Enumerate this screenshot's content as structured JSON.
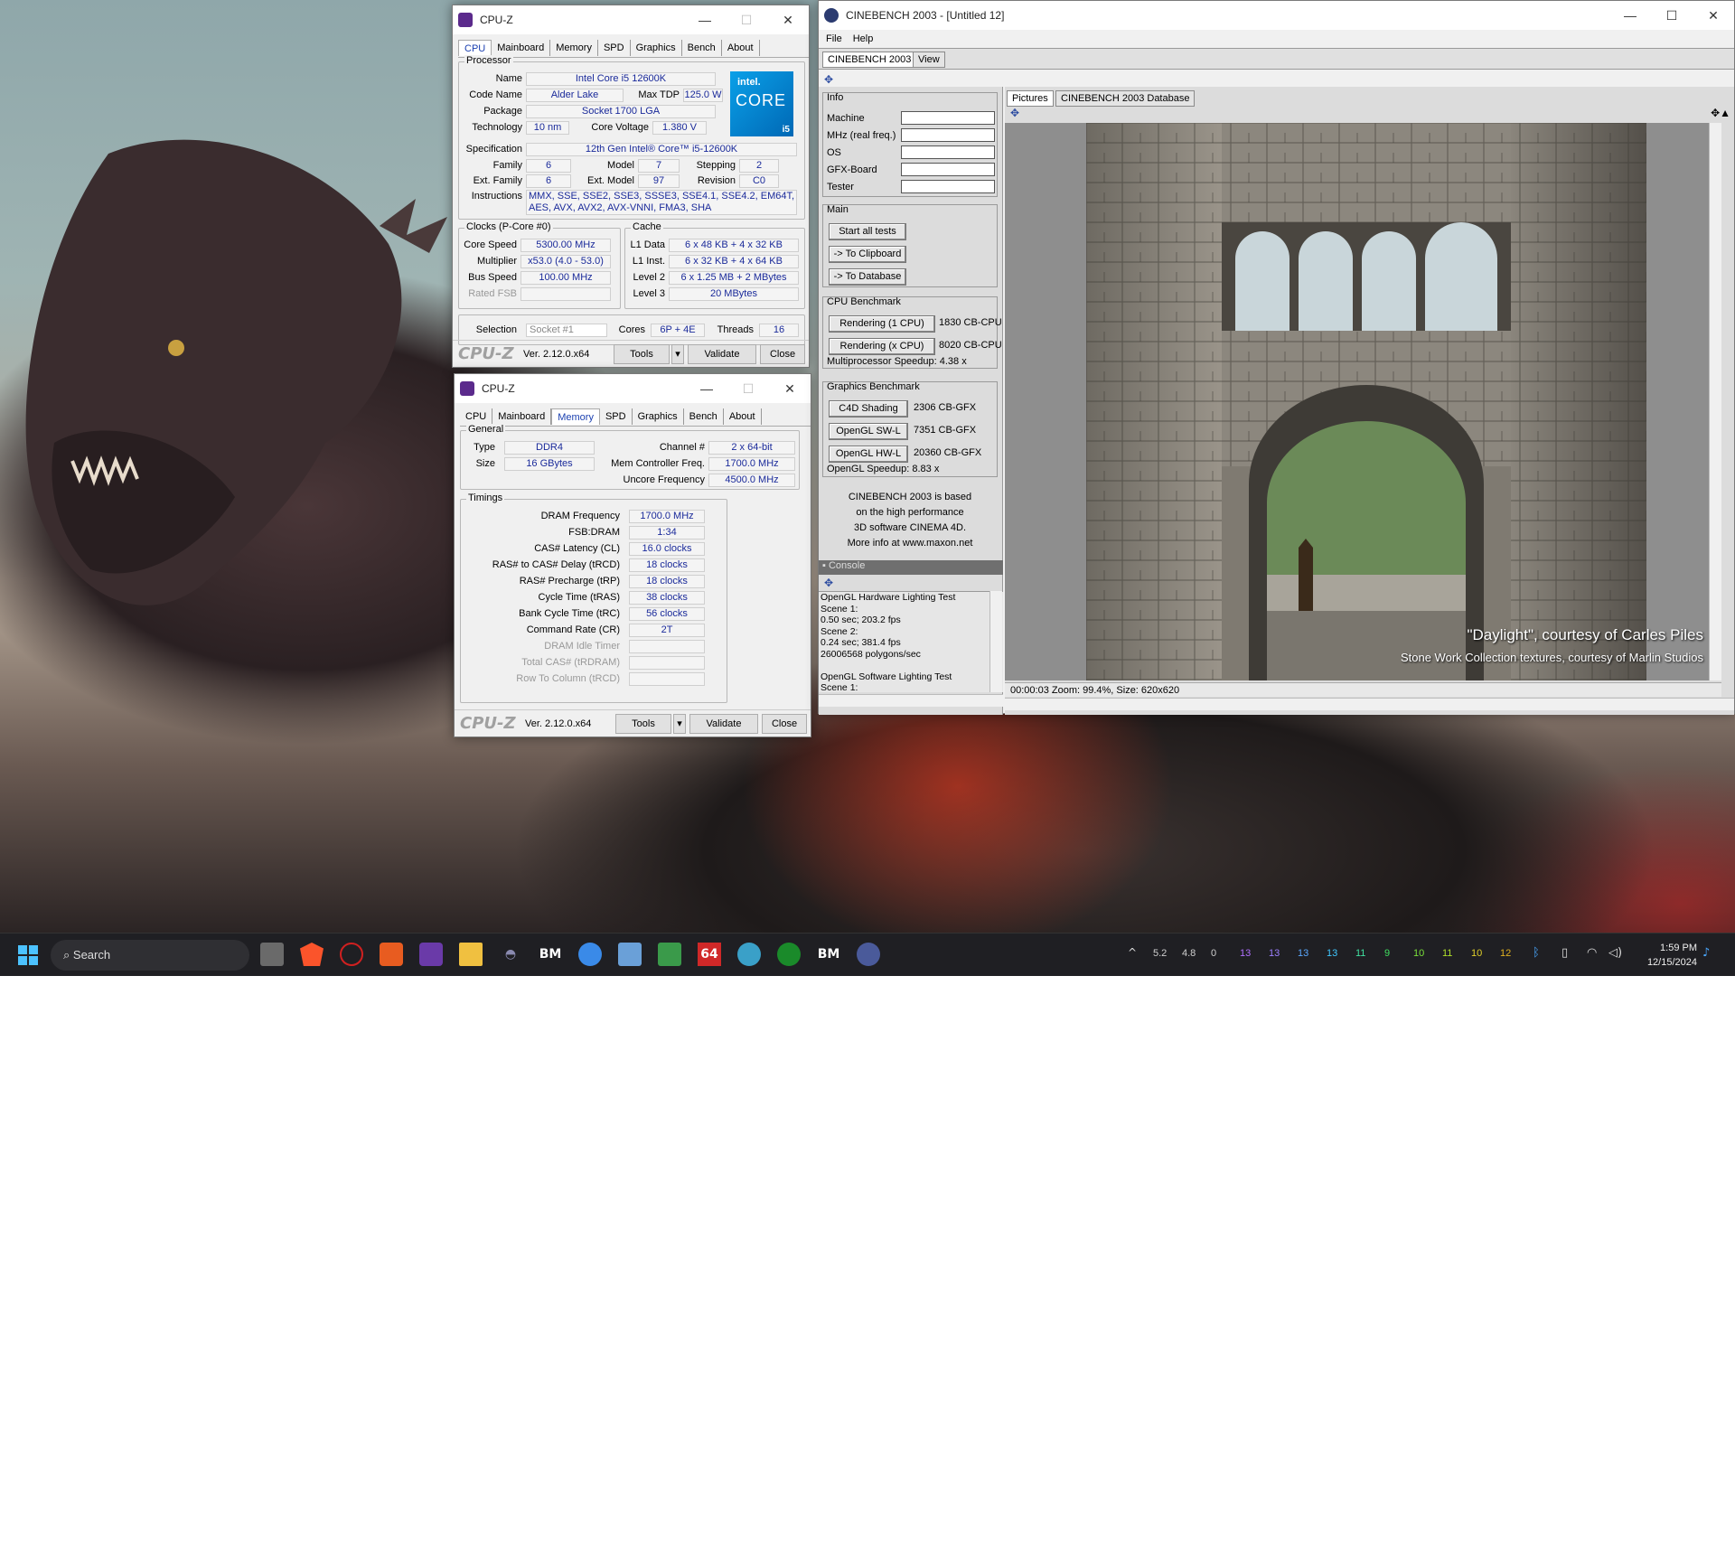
{
  "desktop": {
    "wallpaper": "godzilla-wallpaper"
  },
  "cpuz1": {
    "title": "CPU-Z",
    "tabs": [
      "CPU",
      "Mainboard",
      "Memory",
      "SPD",
      "Graphics",
      "Bench",
      "About"
    ],
    "active_tab": "CPU",
    "processor": {
      "group": "Processor",
      "name_label": "Name",
      "name": "Intel Core i5 12600K",
      "code_label": "Code Name",
      "code": "Alder Lake",
      "tdp_label": "Max TDP",
      "tdp": "125.0 W",
      "package_label": "Package",
      "package": "Socket 1700 LGA",
      "tech_label": "Technology",
      "tech": "10 nm",
      "voltage_label": "Core Voltage",
      "voltage": "1.380 V",
      "spec_label": "Specification",
      "spec": "12th Gen Intel® Core™ i5-12600K",
      "family_label": "Family",
      "family": "6",
      "model_label": "Model",
      "model": "7",
      "stepping_label": "Stepping",
      "stepping": "2",
      "extfamily_label": "Ext. Family",
      "extfamily": "6",
      "extmodel_label": "Ext. Model",
      "extmodel": "97",
      "revision_label": "Revision",
      "revision": "C0",
      "instr_label": "Instructions",
      "instr": "MMX, SSE, SSE2, SSE3, SSSE3, SSE4.1, SSE4.2, EM64T, AES, AVX, AVX2, AVX-VNNI, FMA3, SHA"
    },
    "logo": {
      "brand": "intel.",
      "line": "CORE",
      "tier": "i5"
    },
    "clocks": {
      "group": "Clocks (P-Core #0)",
      "speed_label": "Core Speed",
      "speed": "5300.00 MHz",
      "mult_label": "Multiplier",
      "mult": "x53.0 (4.0 - 53.0)",
      "bus_label": "Bus Speed",
      "bus": "100.00 MHz",
      "fsb_label": "Rated FSB",
      "fsb": ""
    },
    "cache": {
      "group": "Cache",
      "l1d_label": "L1 Data",
      "l1d": "6 x 48 KB + 4 x 32 KB",
      "l1i_label": "L1 Inst.",
      "l1i": "6 x 32 KB + 4 x 64 KB",
      "l2_label": "Level 2",
      "l2": "6 x 1.25 MB + 2 MBytes",
      "l3_label": "Level 3",
      "l3": "20 MBytes"
    },
    "sel": {
      "sel_label": "Selection",
      "sel": "Socket #1",
      "cores_label": "Cores",
      "cores": "6P + 4E",
      "threads_label": "Threads",
      "threads": "16"
    },
    "footer": {
      "logo": "CPU-Z",
      "ver": "Ver. 2.12.0.x64",
      "tools": "Tools",
      "validate": "Validate",
      "close": "Close"
    }
  },
  "cpuz2": {
    "title": "CPU-Z",
    "tabs": [
      "CPU",
      "Mainboard",
      "Memory",
      "SPD",
      "Graphics",
      "Bench",
      "About"
    ],
    "active_tab": "Memory",
    "general": {
      "group": "General",
      "type_label": "Type",
      "type": "DDR4",
      "size_label": "Size",
      "size": "16 GBytes",
      "channel_label": "Channel #",
      "channel": "2 x 64-bit",
      "mcf_label": "Mem Controller Freq.",
      "mcf": "1700.0 MHz",
      "uncore_label": "Uncore Frequency",
      "uncore": "4500.0 MHz"
    },
    "timings": {
      "group": "Timings",
      "rows": [
        {
          "label": "DRAM Frequency",
          "value": "1700.0 MHz",
          "dis": false
        },
        {
          "label": "FSB:DRAM",
          "value": "1:34",
          "dis": false
        },
        {
          "label": "CAS# Latency (CL)",
          "value": "16.0 clocks",
          "dis": false
        },
        {
          "label": "RAS# to CAS# Delay (tRCD)",
          "value": "18 clocks",
          "dis": false
        },
        {
          "label": "RAS# Precharge (tRP)",
          "value": "18 clocks",
          "dis": false
        },
        {
          "label": "Cycle Time (tRAS)",
          "value": "38 clocks",
          "dis": false
        },
        {
          "label": "Bank Cycle Time (tRC)",
          "value": "56 clocks",
          "dis": false
        },
        {
          "label": "Command Rate (CR)",
          "value": "2T",
          "dis": false
        },
        {
          "label": "DRAM Idle Timer",
          "value": "",
          "dis": true
        },
        {
          "label": "Total CAS# (tRDRAM)",
          "value": "",
          "dis": true
        },
        {
          "label": "Row To Column (tRCD)",
          "value": "",
          "dis": true
        }
      ]
    },
    "footer": {
      "logo": "CPU-Z",
      "ver": "Ver. 2.12.0.x64",
      "tools": "Tools",
      "validate": "Validate",
      "close": "Close"
    }
  },
  "cine": {
    "title": "CINEBENCH 2003 - [Untitled 12]",
    "menu": [
      "File",
      "Help"
    ],
    "tabs": [
      "CINEBENCH 2003",
      "View"
    ],
    "info": {
      "group": "Info",
      "fields": [
        "Machine",
        "MHz (real freq.)",
        "OS",
        "GFX-Board",
        "Tester"
      ]
    },
    "main": {
      "group": "Main",
      "b1": "Start all tests",
      "b2": "-> To Clipboard",
      "b3": "-> To Database"
    },
    "cpu": {
      "group": "CPU Benchmark",
      "b1": "Rendering (1 CPU)",
      "r1": "1830 CB-CPU",
      "b2": "Rendering (x CPU)",
      "r2": "8020 CB-CPU",
      "speedup": "Multiprocessor Speedup:  4.38 x"
    },
    "gfx": {
      "group": "Graphics Benchmark",
      "b1": "C4D Shading",
      "r1": "2306 CB-GFX",
      "b2": "OpenGL SW-L",
      "r2": "7351 CB-GFX",
      "b3": "OpenGL HW-L",
      "r3": "20360 CB-GFX",
      "speedup": "OpenGL Speedup:  8.83 x"
    },
    "about": [
      "CINEBENCH 2003 is based",
      "on the high performance",
      "3D software CINEMA 4D.",
      "More info at www.maxon.net"
    ],
    "console": {
      "title": "Console",
      "lines": [
        "OpenGL Hardware Lighting Test",
        "Scene 1:",
        "0.50 sec; 203.2 fps",
        "Scene 2:",
        "0.24 sec; 381.4 fps",
        "26006568 polygons/sec",
        "",
        "OpenGL Software Lighting Test",
        "Scene 1:"
      ]
    },
    "ptabs": [
      "Pictures",
      "CINEBENCH 2003 Database"
    ],
    "caption1": "\"Daylight\", courtesy of Carles Piles",
    "caption2": "Stone Work Collection textures, courtesy of Marlin Studios",
    "status": "00:00:03   Zoom: 99.4%, Size: 620x620"
  },
  "taskbar": {
    "search": "Search",
    "apps": [
      "start-icon",
      "task-view-icon",
      "brave-icon",
      "hwinfo-icon",
      "app-cube-icon",
      "cpuz-icon",
      "file-explorer-icon",
      "gamepad-icon",
      "bm-icon",
      "chrome-icon",
      "gpu-tool-icon",
      "gpu-z-icon",
      "aida64-icon",
      "globe-icon",
      "xbox-icon",
      "bm-icon-2",
      "cinebench-icon"
    ],
    "app_texts": {
      "bm": "BM",
      "aida": "64"
    },
    "tray_nums": [
      "5.2",
      "4.8",
      "0",
      "13",
      "13",
      "13",
      "13",
      "11",
      "9",
      "10",
      "11",
      "10",
      "12"
    ],
    "tray_colors": [
      "#cfcfcf",
      "#cfcfcf",
      "#cfcfcf",
      "#b070ff",
      "#9d80ff",
      "#5aa8ff",
      "#40c8ff",
      "#40e0a0",
      "#40e060",
      "#7ae03a",
      "#b0e02a",
      "#e0d02a",
      "#e0b020"
    ],
    "time": "1:59 PM",
    "date": "12/15/2024"
  }
}
